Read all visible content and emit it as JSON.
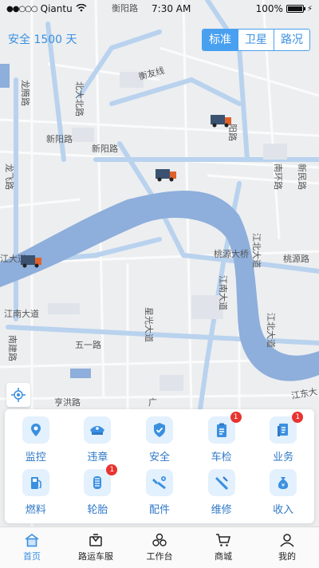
{
  "status_bar": {
    "carrier": "Qiantu",
    "time": "7:30 AM",
    "battery": "100%",
    "battery_level": 1.0
  },
  "safe_days": "安全 1500 天",
  "map_layers": [
    {
      "label": "标准",
      "active": true
    },
    {
      "label": "卫星",
      "active": false
    },
    {
      "label": "路况",
      "active": false
    }
  ],
  "map_labels": {
    "hengyang": "衡阳路",
    "hengyou": "衡友线",
    "beidabei": "北大北路",
    "longteng": "龙腾路",
    "xinyang1": "新阳路",
    "xinyang2": "新阳路",
    "longfei": "龙飞路",
    "nanhuan": "南环路",
    "xinmin": "新民路",
    "yangqiao": "阳路",
    "jiangdadao": "江大道",
    "taoyuan": "桃源大桥",
    "jiangbei": "江北大道",
    "taoyuanlu": "桃源路",
    "jiangnan": "江南大道",
    "jiangnan2": "江南大道",
    "nanjian": "南建路",
    "xingguang": "星光大道",
    "wuyi": "五一路",
    "jiangbei2": "江北大道",
    "hengyu": "亨洪路",
    "guang": "广",
    "jiangdong": "江东大"
  },
  "features": [
    {
      "label": "监控",
      "icon": "location-pin-icon",
      "badge": null
    },
    {
      "label": "违章",
      "icon": "police-cap-icon",
      "badge": null
    },
    {
      "label": "安全",
      "icon": "shield-check-icon",
      "badge": null
    },
    {
      "label": "车检",
      "icon": "clipboard-icon",
      "badge": "1"
    },
    {
      "label": "业务",
      "icon": "document-icon",
      "badge": "1"
    },
    {
      "label": "燃料",
      "icon": "fuel-pump-icon",
      "badge": null
    },
    {
      "label": "轮胎",
      "icon": "tire-icon",
      "badge": "1"
    },
    {
      "label": "配件",
      "icon": "wrench-bolt-icon",
      "badge": null
    },
    {
      "label": "维修",
      "icon": "repair-tool-icon",
      "badge": null
    },
    {
      "label": "收入",
      "icon": "money-bag-icon",
      "badge": null
    }
  ],
  "tabs": [
    {
      "label": "首页",
      "icon": "home-icon",
      "active": true
    },
    {
      "label": "路运车服",
      "icon": "truck-service-icon",
      "active": false
    },
    {
      "label": "工作台",
      "icon": "workbench-icon",
      "active": false
    },
    {
      "label": "商城",
      "icon": "cart-icon",
      "active": false
    },
    {
      "label": "我的",
      "icon": "user-icon",
      "active": false
    }
  ],
  "colors": {
    "accent": "#3a90e0",
    "water": "#8eaedb",
    "road_major": "#b9d2ee",
    "badge": "#e8332f"
  }
}
